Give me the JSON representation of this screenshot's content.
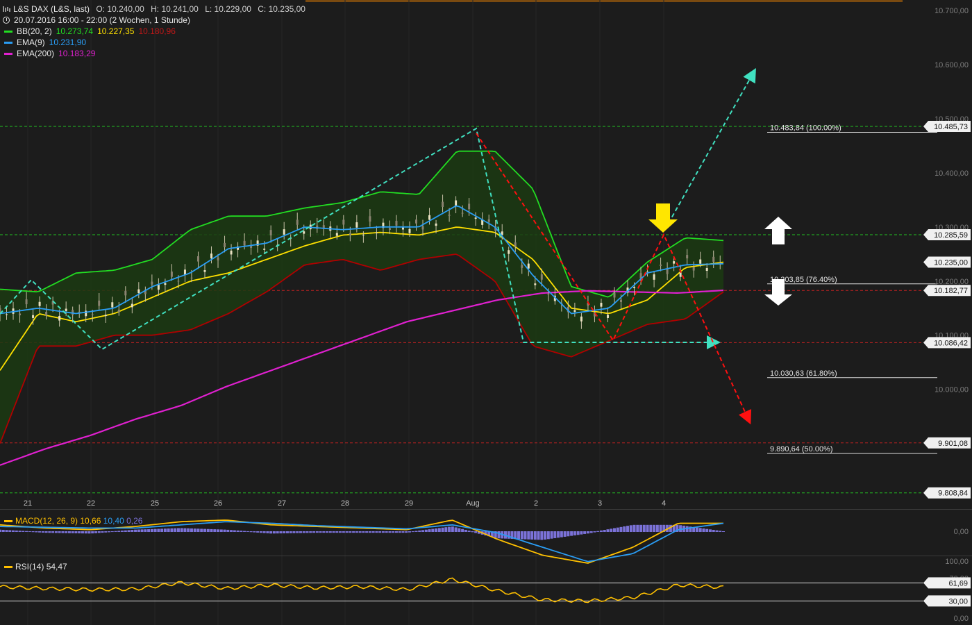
{
  "header": {
    "instrument": "L&S DAX (L&S, last)",
    "open": "O: 10.240,00",
    "high": "H: 10.241,00",
    "low": "L: 10.229,00",
    "close": "C: 10.235,00",
    "period": "20.07.2016 16:00 - 22:00 (2 Wochen, 1 Stunde)"
  },
  "legend": {
    "bb": {
      "label": "BB(20, 2)",
      "v1": "10.273,74",
      "v2": "10.227,35",
      "v3": "10.180,96"
    },
    "ema9": {
      "label": "EMA(9)",
      "v": "10.231,90"
    },
    "ema200": {
      "label": "EMA(200)",
      "v": "10.183,29"
    }
  },
  "macd_legend": {
    "label": "MACD(12, 26, 9)",
    "v1": "10,66",
    "v2": "10,40",
    "v3": "0,26"
  },
  "rsi_legend": {
    "label": "RSI(14)",
    "v": "54,47"
  },
  "colors": {
    "background": "#1c1c1c",
    "bb_upper": "#22dd22",
    "bb_lower": "#b00000",
    "bb_mid": "#ffe000",
    "bb_fill": "#1b3a12",
    "ema9": "#2a9df4",
    "ema200": "#e020d0",
    "fib_line": "#e0e0e0",
    "green_dash": "#22c022",
    "red_dash": "#c02020",
    "cyan_arrow": "#40e0c0",
    "red_arrow": "#ff1010",
    "yellow_arrow": "#ffe600",
    "white_arrow": "#ffffff",
    "macd_hist": "#7b72d8",
    "rsi": "#ffc000"
  },
  "chart_data": {
    "type": "line",
    "y_axis": {
      "ticks": [
        "10.700,00",
        "10.600,00",
        "10.500,00",
        "10.400,00",
        "10.300,00",
        "10.200,00",
        "10.100,00",
        "10.000,00"
      ],
      "ylim": [
        9800,
        10700
      ]
    },
    "x_axis": {
      "ticks": [
        "21",
        "22",
        "25",
        "26",
        "27",
        "28",
        "29",
        "Aug",
        "2",
        "3",
        "4"
      ]
    },
    "price_tags": [
      {
        "value": 10485.73,
        "text": "10.485,73"
      },
      {
        "value": 10285.59,
        "text": "10.285,59"
      },
      {
        "value": 10235.0,
        "text": "10.235,00"
      },
      {
        "value": 10182.77,
        "text": "10.182,77"
      },
      {
        "value": 10086.42,
        "text": "10.086,42"
      },
      {
        "value": 9901.08,
        "text": "9.901,08"
      },
      {
        "value": 9808.84,
        "text": "9.808,84"
      }
    ],
    "fib_levels": [
      {
        "value": 10483.84,
        "text": "10.483,84 (100.00%)"
      },
      {
        "value": 10203.85,
        "text": "10.203,85 (76.40%)"
      },
      {
        "value": 10030.63,
        "text": "10.030,63 (61.80%)"
      },
      {
        "value": 9890.64,
        "text": "9.890,64 (50.00%)"
      }
    ],
    "horizontal_lines": [
      {
        "value": 10485.73,
        "style": "green-dash"
      },
      {
        "value": 10285.59,
        "style": "green-dash"
      },
      {
        "value": 10182.77,
        "style": "red-dash"
      },
      {
        "value": 10086.42,
        "style": "red-dash"
      },
      {
        "value": 9901.08,
        "style": "red-dash"
      },
      {
        "value": 9808.84,
        "style": "green-dash"
      }
    ],
    "series": [
      {
        "name": "EMA(200)",
        "values": [
          9860,
          9890,
          9915,
          9945,
          9970,
          10005,
          10035,
          10065,
          10095,
          10125,
          10145,
          10165,
          10178,
          10182,
          10180,
          10178,
          10183
        ]
      },
      {
        "name": "BB(20, 2)",
        "values": [
          10230,
          10235,
          10230,
          10260,
          10260,
          10290,
          10330,
          10320,
          10330,
          10330,
          10440,
          10440,
          10370,
          10190,
          10170,
          10290,
          10280
        ]
      }
    ],
    "macd": {
      "axis_ticks": [
        "0,00"
      ],
      "series": [
        {
          "name": "MACD(12, 26, 9)",
          "values": [
            8,
            4,
            2,
            6,
            12,
            14,
            8,
            6,
            4,
            2,
            14,
            -10,
            -30,
            -40,
            -20,
            10,
            10
          ]
        },
        {
          "name": "Signal",
          "values": [
            6,
            5,
            4,
            4,
            8,
            12,
            10,
            7,
            5,
            3,
            8,
            -2,
            -20,
            -38,
            -28,
            2,
            10
          ]
        }
      ]
    },
    "rsi": {
      "axis_ticks": [
        "100,00",
        "70,00",
        "30,00",
        "0,00"
      ],
      "tags": [
        {
          "value": 61.69,
          "text": "61,69"
        },
        {
          "value": 30.0,
          "text": "30,00"
        }
      ],
      "values": [
        55,
        52,
        50,
        51,
        62,
        52,
        58,
        53,
        55,
        50,
        68,
        48,
        32,
        30,
        36,
        58,
        54
      ]
    },
    "drawn_lines": [
      {
        "name": "cyan zigzag"
      },
      {
        "name": "red zigzag"
      }
    ]
  }
}
